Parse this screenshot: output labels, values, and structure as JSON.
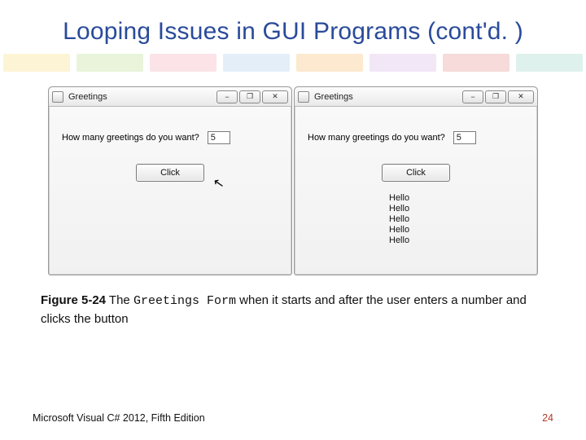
{
  "title": "Looping Issues in GUI Programs (cont'd. )",
  "stripes": [
    "#f6d258",
    "#a7d36a",
    "#f08fa0",
    "#8fbde8",
    "#f4a93f",
    "#c7a0db",
    "#de6b6b",
    "#7fc9b8"
  ],
  "form": {
    "appTitle": "Greetings",
    "minLabel": "−",
    "maxLabel": "❐",
    "closeLabel": "✕",
    "promptLabel": "How many greetings do you want?",
    "inputValue": "5",
    "buttonLabel": "Click",
    "outputLine": "Hello",
    "outputCount": 5
  },
  "caption": {
    "figLabel": "Figure 5-24",
    "pre": " The ",
    "mono": "Greetings Form",
    "post": " when it starts and after the user enters a number and clicks the button"
  },
  "footer": {
    "left": "Microsoft Visual C# 2012, Fifth Edition",
    "right": "24"
  }
}
